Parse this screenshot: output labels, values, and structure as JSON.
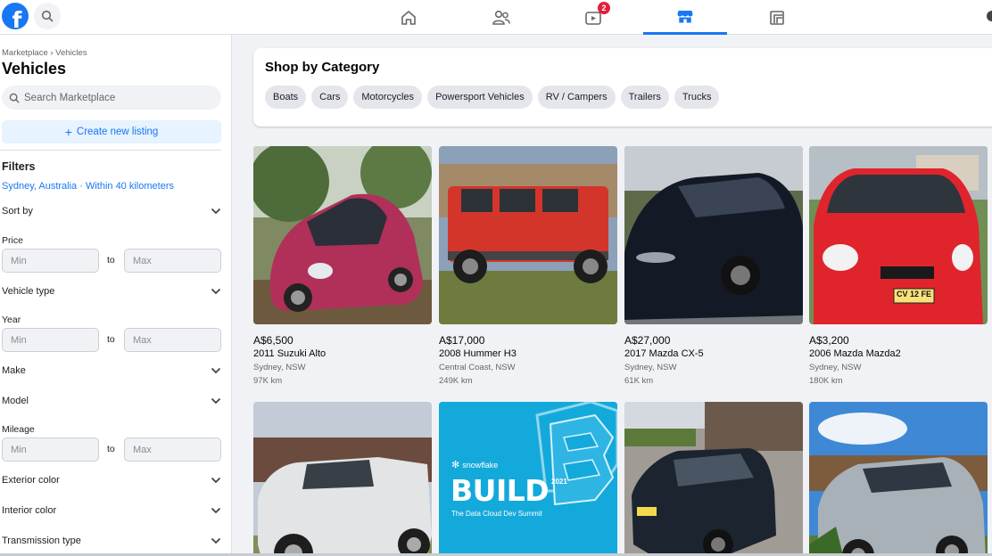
{
  "topbar": {
    "logo_letter": "f",
    "badge_count": "2",
    "nav_icons": [
      "home-icon",
      "friends-icon",
      "watch-icon",
      "marketplace-icon",
      "gaming-icon"
    ],
    "accent_color": "#1877f2"
  },
  "sidebar": {
    "breadcrumb": "Marketplace › Vehicles",
    "title": "Vehicles",
    "search_placeholder": "Search Marketplace",
    "create_label": "Create new listing",
    "filters_heading": "Filters",
    "location": "Sydney, Australia · Within 40 kilometers",
    "sort_by": "Sort by",
    "price_label": "Price",
    "vehicle_type": "Vehicle type",
    "year_label": "Year",
    "make": "Make",
    "model": "Model",
    "mileage_label": "Mileage",
    "exterior_color": "Exterior color",
    "interior_color": "Interior color",
    "transmission_type": "Transmission type",
    "min_placeholder": "Min",
    "max_placeholder": "Max",
    "to_label": "to"
  },
  "category": {
    "title": "Shop by Category",
    "chips": [
      "Boats",
      "Cars",
      "Motorcycles",
      "Powersport Vehicles",
      "RV / Campers",
      "Trailers",
      "Trucks"
    ]
  },
  "listings": [
    {
      "price": "A$6,500",
      "title": "2011 Suzuki Alto",
      "location": "Sydney, NSW",
      "mileage": "97K km"
    },
    {
      "price": "A$17,000",
      "title": "2008 Hummer H3",
      "location": "Central Coast, NSW",
      "mileage": "249K km"
    },
    {
      "price": "A$27,000",
      "title": "2017 Mazda CX-5",
      "location": "Sydney, NSW",
      "mileage": "61K km"
    },
    {
      "price": "A$3,200",
      "title": "2006 Mazda Mazda2",
      "location": "Sydney, NSW",
      "mileage": "180K km"
    }
  ],
  "ad": {
    "brand": "snowflake",
    "headline": "BUILD",
    "year": "2021",
    "subline": "The Data Cloud Dev Summit"
  },
  "plates": {
    "mazda2": "CV 12 FE"
  }
}
